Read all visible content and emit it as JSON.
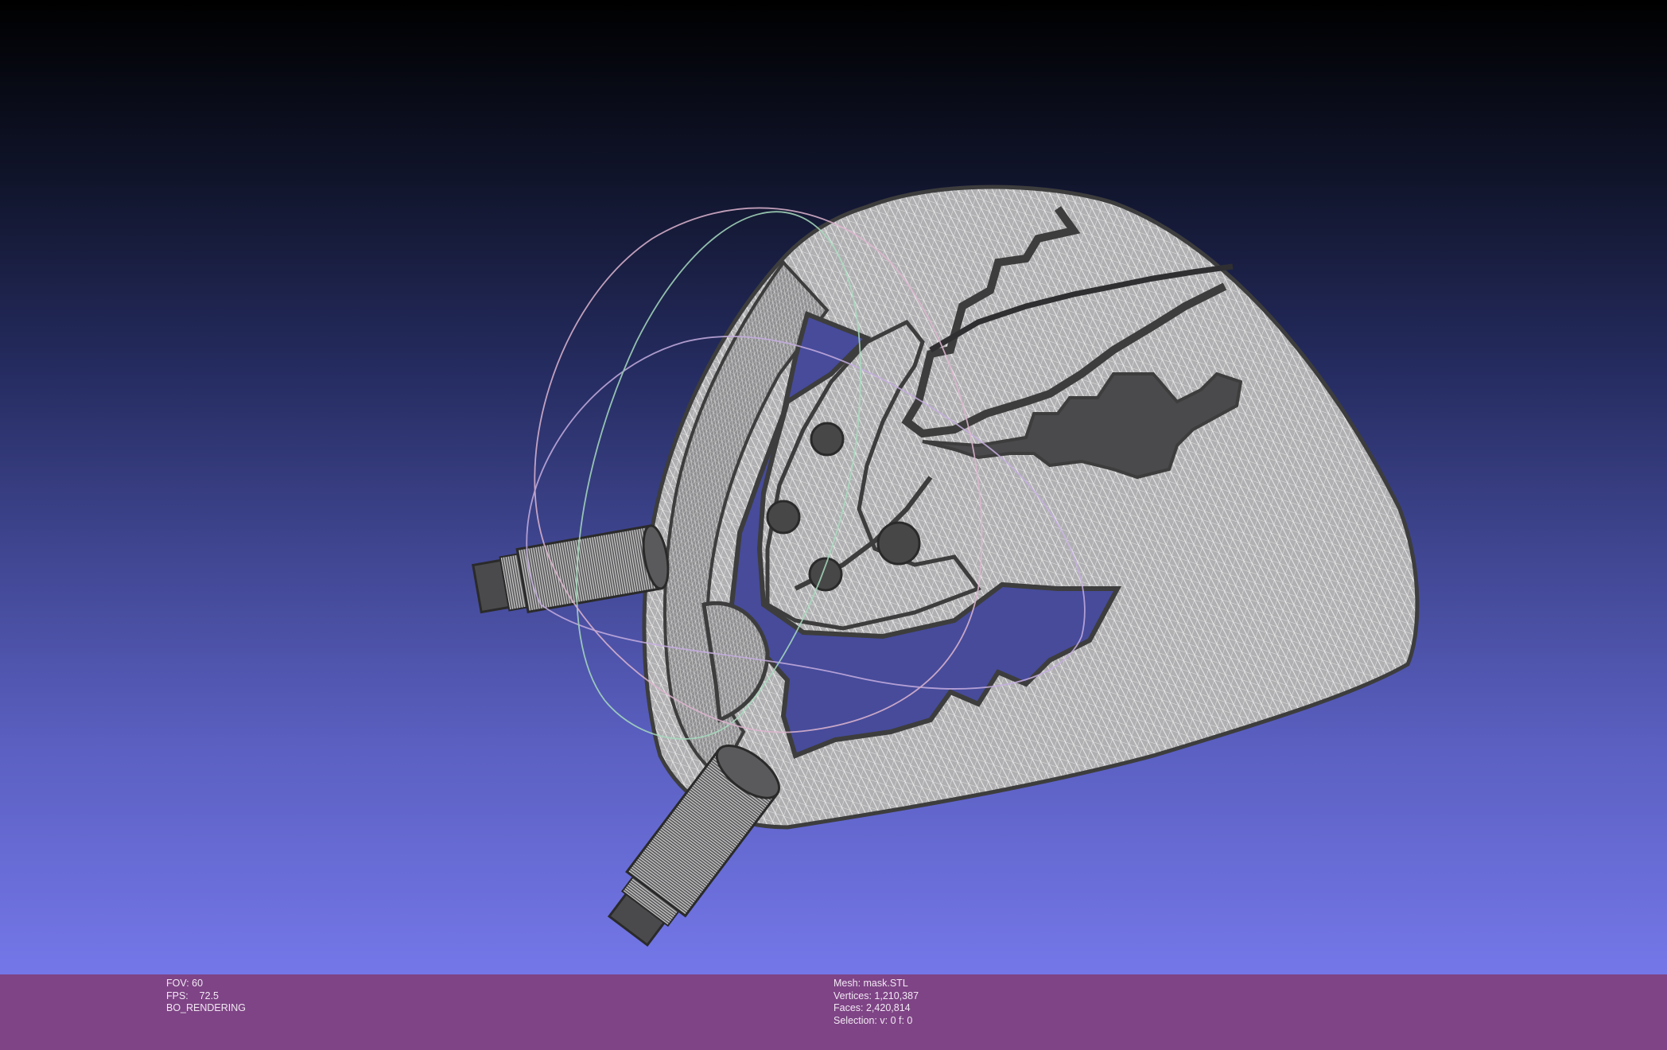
{
  "viewport": {
    "background_top": "#000000",
    "background_bottom": "#7477e8",
    "mesh_fill": "#a9a9ab",
    "mesh_wire": "#ffffff",
    "mesh_edge": "#3d3d3d",
    "trackball_colors": [
      "#c2a8d9",
      "#a8d9bc",
      "#d9b4cc"
    ],
    "model_icon": "3d-mesh-icon",
    "trackball_icon": "trackball-icon"
  },
  "info": {
    "fov": "FOV: 60",
    "fps": "FPS:    72.5",
    "render_mode": "BO_RENDERING",
    "mesh": "Mesh: mask.STL",
    "vertices": "Vertices: 1,210,387",
    "faces": "Faces: 2,420,814",
    "selection": "Selection: v: 0 f: 0"
  },
  "colors": {
    "infobar_bg": "#7e4485",
    "infobar_text": "#f2e8f4"
  }
}
